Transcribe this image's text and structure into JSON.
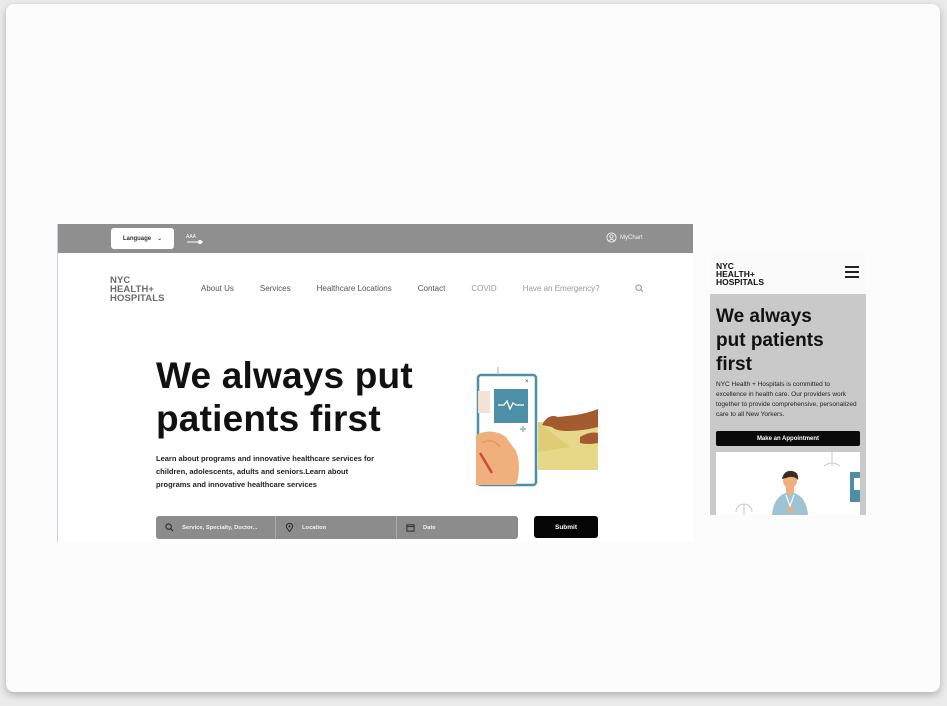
{
  "desktop": {
    "topbar": {
      "language_label": "Language",
      "font_size_label": "AAA",
      "mychart_label": "MyChart"
    },
    "logo": {
      "line1": "NYC",
      "line2": "HEALTH+",
      "line3": "HOSPITALS"
    },
    "nav": {
      "items": [
        "About Us",
        "Services",
        "Healthcare Locations",
        "Contact",
        "COVID",
        "Have an Emergency?"
      ]
    },
    "hero": {
      "title_line1": "We always put",
      "title_line2": "patients first",
      "description": "Learn about programs and innovative healthcare services for children, adolescents, adults and seniors.Learn about programs and innovative healthcare services"
    },
    "search": {
      "service_placeholder": "Service, Specialty, Doctor...",
      "location_placeholder": "Location",
      "date_placeholder": "Date",
      "submit_label": "Submit"
    }
  },
  "mobile": {
    "logo": {
      "line1": "NYC",
      "line2": "HEALTH+",
      "line3": "HOSPITALS"
    },
    "hero": {
      "title_line1": "We always",
      "title_line2": "put patients",
      "title_line3": "first",
      "description": "NYC Health + Hospitals is committed to excellence in health care. Our providers work together to provide comprehensive, personalized care to all New Yorkers.",
      "button_label": "Make an Appointment"
    }
  },
  "colors": {
    "topbar": "#8f8f8f",
    "search_bar": "#8c8c8c",
    "submit": "#050505",
    "mobile_hero_bg": "#c9c9c9",
    "illustration_teal": "#4d8fa6",
    "illustration_yellow": "#e7d789",
    "illustration_skin": "#efb07d",
    "illustration_brown": "#a35a2e"
  }
}
